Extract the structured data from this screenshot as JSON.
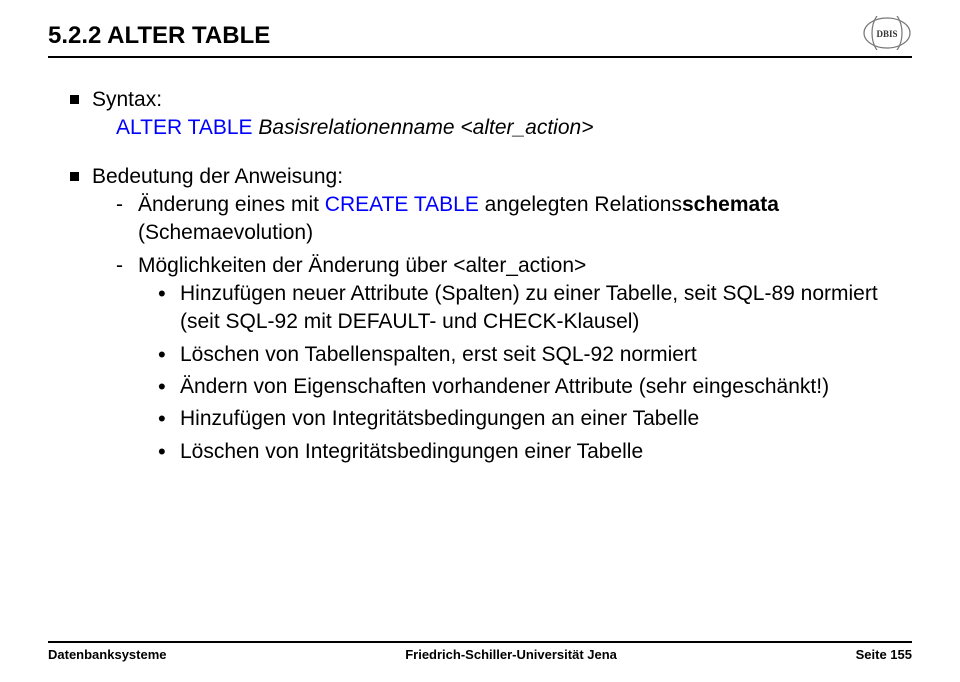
{
  "section_number": "5.2.2",
  "section_title": "ALTER TABLE",
  "syntax_label": "Syntax:",
  "syntax_line": {
    "kw": "ALTER TABLE",
    "arg1": "Basisrelationenname",
    "arg2": "<alter_action>"
  },
  "meaning_label": "Bedeutung der Anweisung:",
  "dash_items": [
    {
      "prefix": "Änderung eines mit ",
      "kw": "CREATE TABLE",
      "mid": " angelegten Relations",
      "bold": "schemata",
      "suffix": " (Schemaevolution)"
    },
    {
      "plain": "Möglichkeiten der Änderung über <alter_action>"
    }
  ],
  "dot_items": [
    "Hinzufügen neuer Attribute (Spalten) zu einer Tabelle, seit SQL-89 normiert (seit SQL-92 mit DEFAULT- und CHECK-Klausel)",
    "Löschen von Tabellenspalten, erst seit SQL-92 normiert",
    "Ändern von Eigenschaften vorhandener Attribute (sehr eingeschänkt!)",
    "Hinzufügen von Integritätsbedingungen an einer Tabelle",
    "Löschen von Integritätsbedingungen einer Tabelle"
  ],
  "footer": {
    "left": "Datenbanksysteme",
    "center": "Friedrich-Schiller-Universität Jena",
    "right": "Seite 155"
  },
  "logo_text": "DBIS"
}
